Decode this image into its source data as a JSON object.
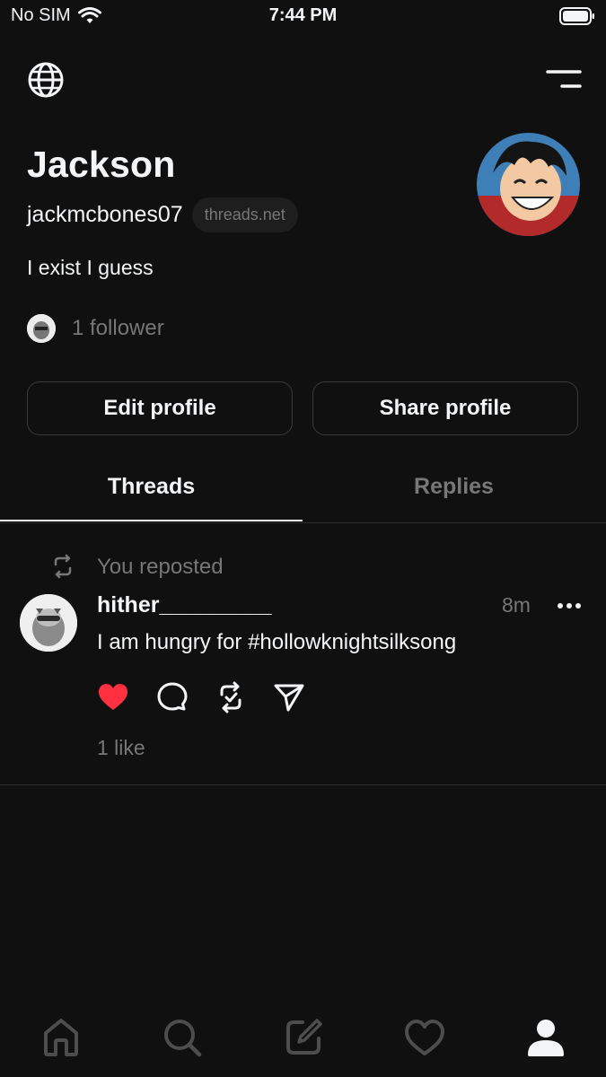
{
  "status": {
    "carrier": "No SIM",
    "time": "7:44 PM"
  },
  "profile": {
    "name": "Jackson",
    "handle": "jackmcbones07",
    "domain": "threads.net",
    "bio": "I exist I guess",
    "followers": "1 follower"
  },
  "buttons": {
    "edit": "Edit profile",
    "share": "Share profile"
  },
  "tabs": [
    {
      "label": "Threads",
      "active": true
    },
    {
      "label": "Replies",
      "active": false
    }
  ],
  "post": {
    "repost_label": "You reposted",
    "username": "hither_________",
    "time": "8m",
    "text": "I am hungry for #hollowknightsilksong",
    "likes": "1 like",
    "liked": true
  },
  "colors": {
    "background": "#101010",
    "text": "#f3f5f7",
    "muted": "#777777",
    "like": "#ff3040"
  },
  "icons": [
    "wifi-icon",
    "battery-icon",
    "globe-icon",
    "menu-icon",
    "repost-icon",
    "more-icon",
    "heart-icon",
    "comment-icon",
    "send-icon",
    "home-icon",
    "search-icon",
    "compose-icon",
    "activity-icon",
    "profile-icon"
  ]
}
